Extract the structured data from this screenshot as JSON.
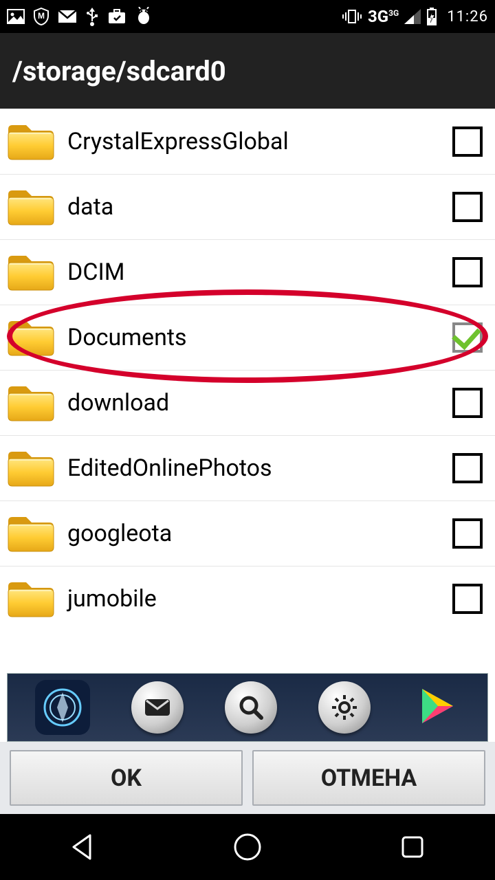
{
  "statusBar": {
    "network": "3G",
    "networkSup": "3G",
    "time": "11:26"
  },
  "title": "/storage/sdcard0",
  "folders": [
    {
      "name": "CrystalExpressGlobal",
      "checked": false,
      "highlighted": false
    },
    {
      "name": "data",
      "checked": false,
      "highlighted": false
    },
    {
      "name": "DCIM",
      "checked": false,
      "highlighted": false
    },
    {
      "name": "Documents",
      "checked": true,
      "highlighted": true
    },
    {
      "name": "download",
      "checked": false,
      "highlighted": false
    },
    {
      "name": "EditedOnlinePhotos",
      "checked": false,
      "highlighted": false
    },
    {
      "name": "googleota",
      "checked": false,
      "highlighted": false
    },
    {
      "name": "jumobile",
      "checked": false,
      "highlighted": false
    }
  ],
  "buttons": {
    "ok": "OK",
    "cancel": "ОТМЕНА"
  }
}
